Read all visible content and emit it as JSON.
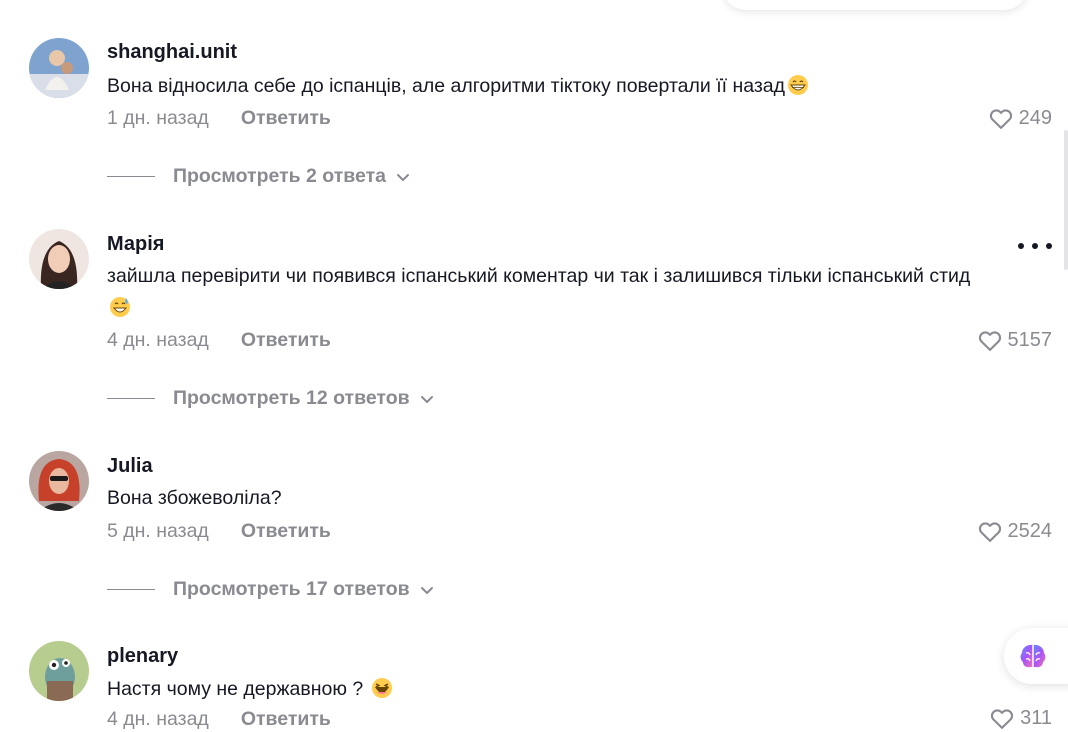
{
  "comments": [
    {
      "username": "shanghai.unit",
      "text": "Вона відносила себе до іспанців, але алгоритми тіктоку повертали її назад",
      "emoji": "grinning-face-emoji",
      "time": "1 дн. назад",
      "reply_label": "Ответить",
      "likes": "249",
      "view_replies": "Просмотреть 2 ответа"
    },
    {
      "username": "Марія",
      "text": "зайшла перевірити чи появився іспанський коментар чи так і залишився тільки іспанський стид",
      "emoji": "sweat-smile-emoji",
      "time": "4 дн. назад",
      "reply_label": "Ответить",
      "likes": "5157",
      "view_replies": "Просмотреть 12 ответов"
    },
    {
      "username": "Julia",
      "text": "Вона збожеволіла?",
      "time": "5 дн. назад",
      "reply_label": "Ответить",
      "likes": "2524",
      "view_replies": "Просмотреть 17 ответов"
    },
    {
      "username": "plenary",
      "text": "Настя чому не державною ?",
      "emoji": "laughing-emoji",
      "time": "4 дн. назад",
      "reply_label": "Ответить",
      "likes": "311"
    }
  ],
  "colors": {
    "text": "#161823",
    "muted": "#8a8b91",
    "accent": "#a855f7"
  },
  "icons": [
    "heart-icon",
    "chevron-down-icon",
    "more-icon",
    "ai-brain-icon"
  ]
}
